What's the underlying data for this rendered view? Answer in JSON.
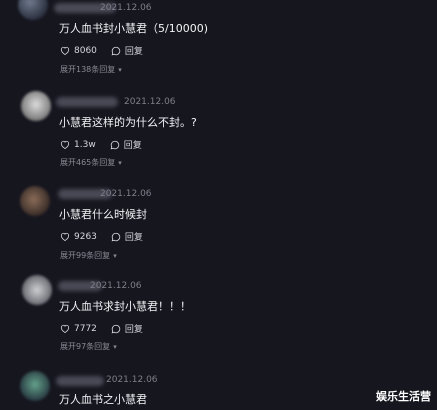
{
  "comments": [
    {
      "date": "2021.12.06",
      "text": "万人血书封小慧君（5/10000)",
      "likes": "8060",
      "reply_label": "回复",
      "expand_label": "展开138条回复"
    },
    {
      "date": "2021.12.06",
      "text": "小慧君这样的为什么不封。?",
      "likes": "1.3w",
      "reply_label": "回复",
      "expand_label": "展开465条回复"
    },
    {
      "date": "2021.12.06",
      "text": "小慧君什么时候封",
      "likes": "9263",
      "reply_label": "回复",
      "expand_label": "展开99条回复"
    },
    {
      "date": "2021.12.06",
      "text": "万人血书求封小慧君！！！",
      "likes": "7772",
      "reply_label": "回复",
      "expand_label": "展开97条回复"
    },
    {
      "date": "2021.12.06",
      "text": "万人血书之小慧君"
    }
  ],
  "watermark": "娱乐生活营",
  "colors": {
    "background": "#16161f",
    "text": "#f2f2f6",
    "muted": "#8a8a96"
  },
  "icons": {
    "like": "heart-icon",
    "reply": "chat-bubble-icon",
    "expand": "chevron-down-icon"
  }
}
